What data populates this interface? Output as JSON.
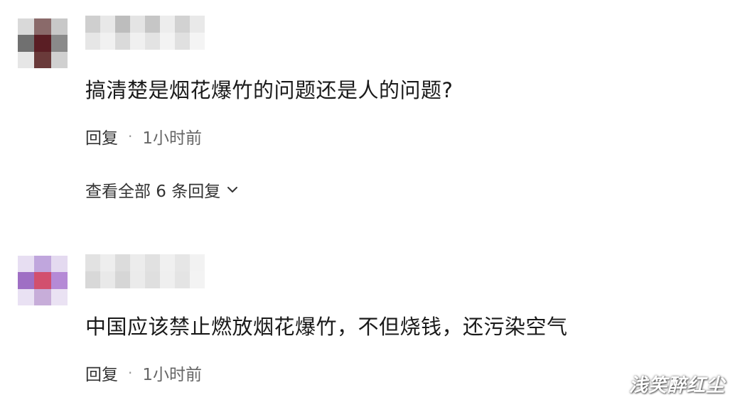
{
  "comments": [
    {
      "text": "搞清楚是烟花爆竹的问题还是人的问题?",
      "reply_label": "回复",
      "separator": "·",
      "time": "1小时前",
      "view_all_label": "查看全部 6 条回复",
      "avatar_colors": [
        "#d9d9d9",
        "#8a6a6a",
        "#c8c8c8",
        "#707070",
        "#5a1e24",
        "#8a8a8a",
        "#e6e6e6",
        "#6a3a3a",
        "#d0d0d0"
      ],
      "name_colors": [
        "#cfcfcf",
        "#e8e8e8",
        "#bdbdbd",
        "#e4e4e4",
        "#c6c6c6",
        "#ededed",
        "#d2d2d2",
        "#e9e9e9",
        "#e6e6e6",
        "#f1f1f1",
        "#dadada",
        "#f0f0f0",
        "#e3e3e3",
        "#f3f3f3",
        "#e0e0e0",
        "#f4f4f4"
      ]
    },
    {
      "text": "中国应该禁止燃放烟花爆竹，不但烧钱，还污染空气",
      "reply_label": "回复",
      "separator": "·",
      "time": "1小时前",
      "avatar_colors": [
        "#e7def2",
        "#c0a6dd",
        "#e4daf0",
        "#9f6fc4",
        "#d2506e",
        "#b58ad6",
        "#e9e1f3",
        "#c7add9",
        "#eae2f3"
      ],
      "name_colors": [
        "#e2e2e2",
        "#eeeeee",
        "#dcdcdc",
        "#ececec",
        "#e1e1e1",
        "#f0f0f0",
        "#e6e6e6",
        "#f2f2f2",
        "#d8d8d8",
        "#e9e9e9",
        "#d6d6d6",
        "#ebebeb",
        "#dfdfdf",
        "#efefef",
        "#e4e4e4",
        "#f3f3f3"
      ]
    }
  ],
  "watermark": "浅笑醉红尘",
  "icons": {
    "expand": "chevron-down-icon"
  }
}
